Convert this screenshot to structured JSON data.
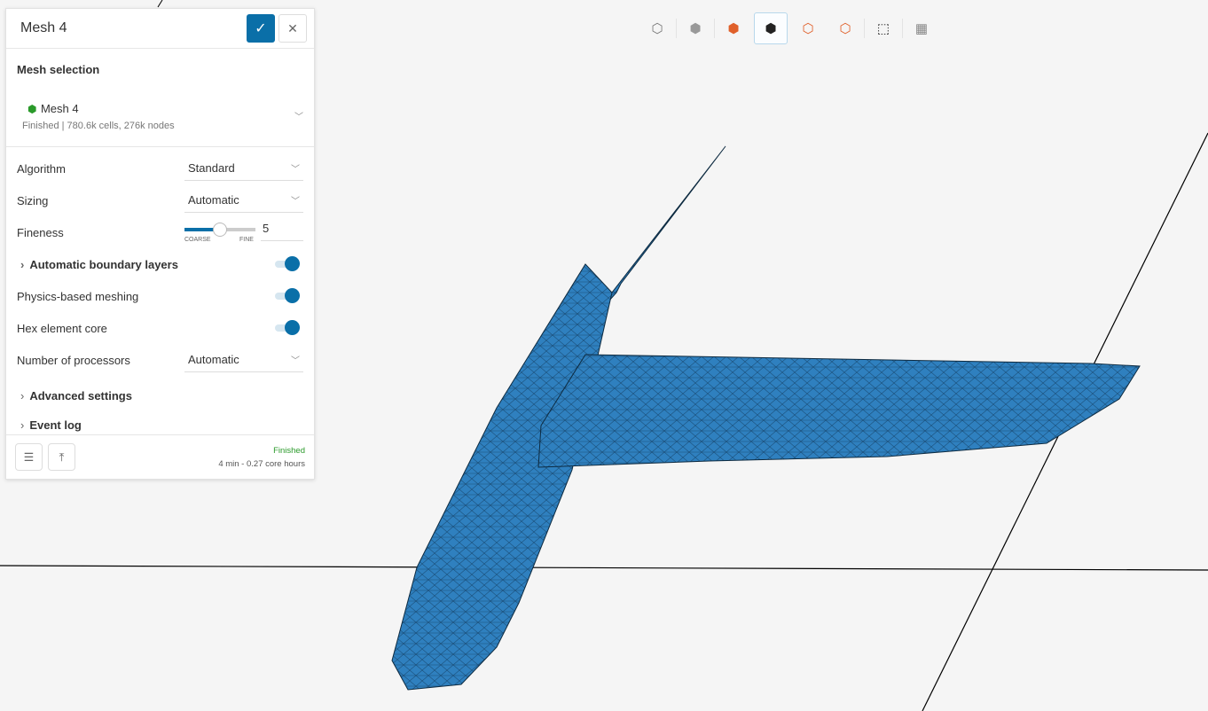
{
  "panel": {
    "title": "Mesh 4",
    "confirm_icon": "check-icon",
    "close_icon": "close-icon",
    "mesh_selection_label": "Mesh selection",
    "mesh": {
      "name": "Mesh 4",
      "status": "Finished | 780.6k cells, 276k nodes"
    },
    "algorithm": {
      "label": "Algorithm",
      "value": "Standard"
    },
    "sizing": {
      "label": "Sizing",
      "value": "Automatic"
    },
    "fineness": {
      "label": "Fineness",
      "value": "5",
      "min_label": "COARSE",
      "max_label": "FINE",
      "fraction": 0.5
    },
    "auto_boundary": {
      "label": "Automatic boundary layers",
      "on": true
    },
    "physics": {
      "label": "Physics-based meshing",
      "on": true
    },
    "hex": {
      "label": "Hex element core",
      "on": true
    },
    "processors": {
      "label": "Number of processors",
      "value": "Automatic"
    },
    "advanced": "Advanced settings",
    "event_log": "Event log",
    "footer": {
      "status": "Finished",
      "time": "4 min - 0.27 core hours",
      "status_color": "#2a9a2a"
    }
  },
  "toolbar": [
    "wireframe-cube-icon",
    "solid-cube-icon",
    "face-select-icon",
    "volume-select-icon",
    "node-select-icon",
    "edge-select-icon",
    "box-select-icon",
    "mesh-view-icon"
  ],
  "colors": {
    "accent": "#0a6fa8",
    "mesh": "#2f7bb5"
  }
}
